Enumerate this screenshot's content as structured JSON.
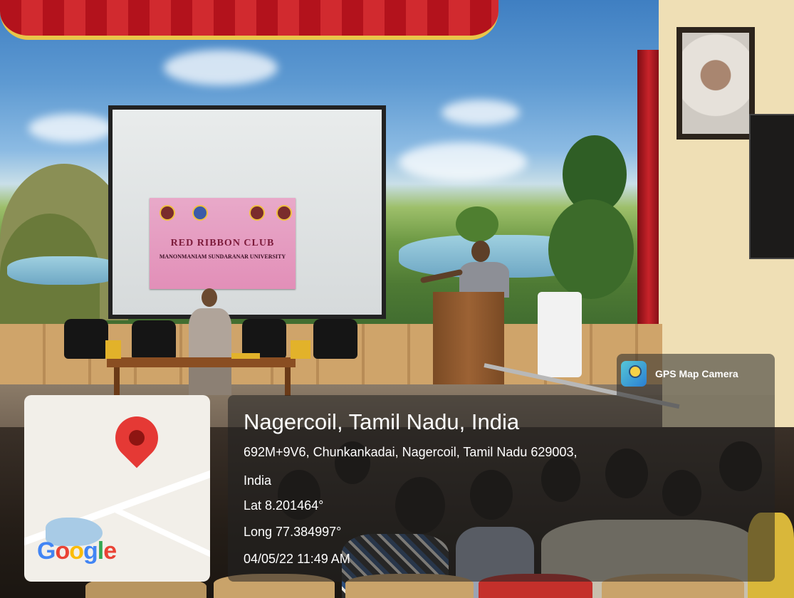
{
  "banner": {
    "title": "RED RIBBON CLUB",
    "subtitle": "MANONMANIAM SUNDARANAR UNIVERSITY"
  },
  "gps_badge": {
    "label": "GPS Map Camera"
  },
  "location": {
    "place": "Nagercoil, Tamil Nadu, India",
    "address_line1": "692M+9V6, Chunkankadai, Nagercoil, Tamil Nadu 629003,",
    "address_line2": "India",
    "latitude": "Lat 8.201464°",
    "longitude": "Long 77.384997°",
    "datetime": "04/05/22 11:49 AM"
  },
  "map": {
    "logo": [
      "G",
      "o",
      "o",
      "g",
      "l",
      "e"
    ],
    "logo_colors": [
      "#4285F4",
      "#EA4335",
      "#FBBC05",
      "#4285F4",
      "#34A853",
      "#EA4335"
    ],
    "pin_color": "#E53935"
  }
}
